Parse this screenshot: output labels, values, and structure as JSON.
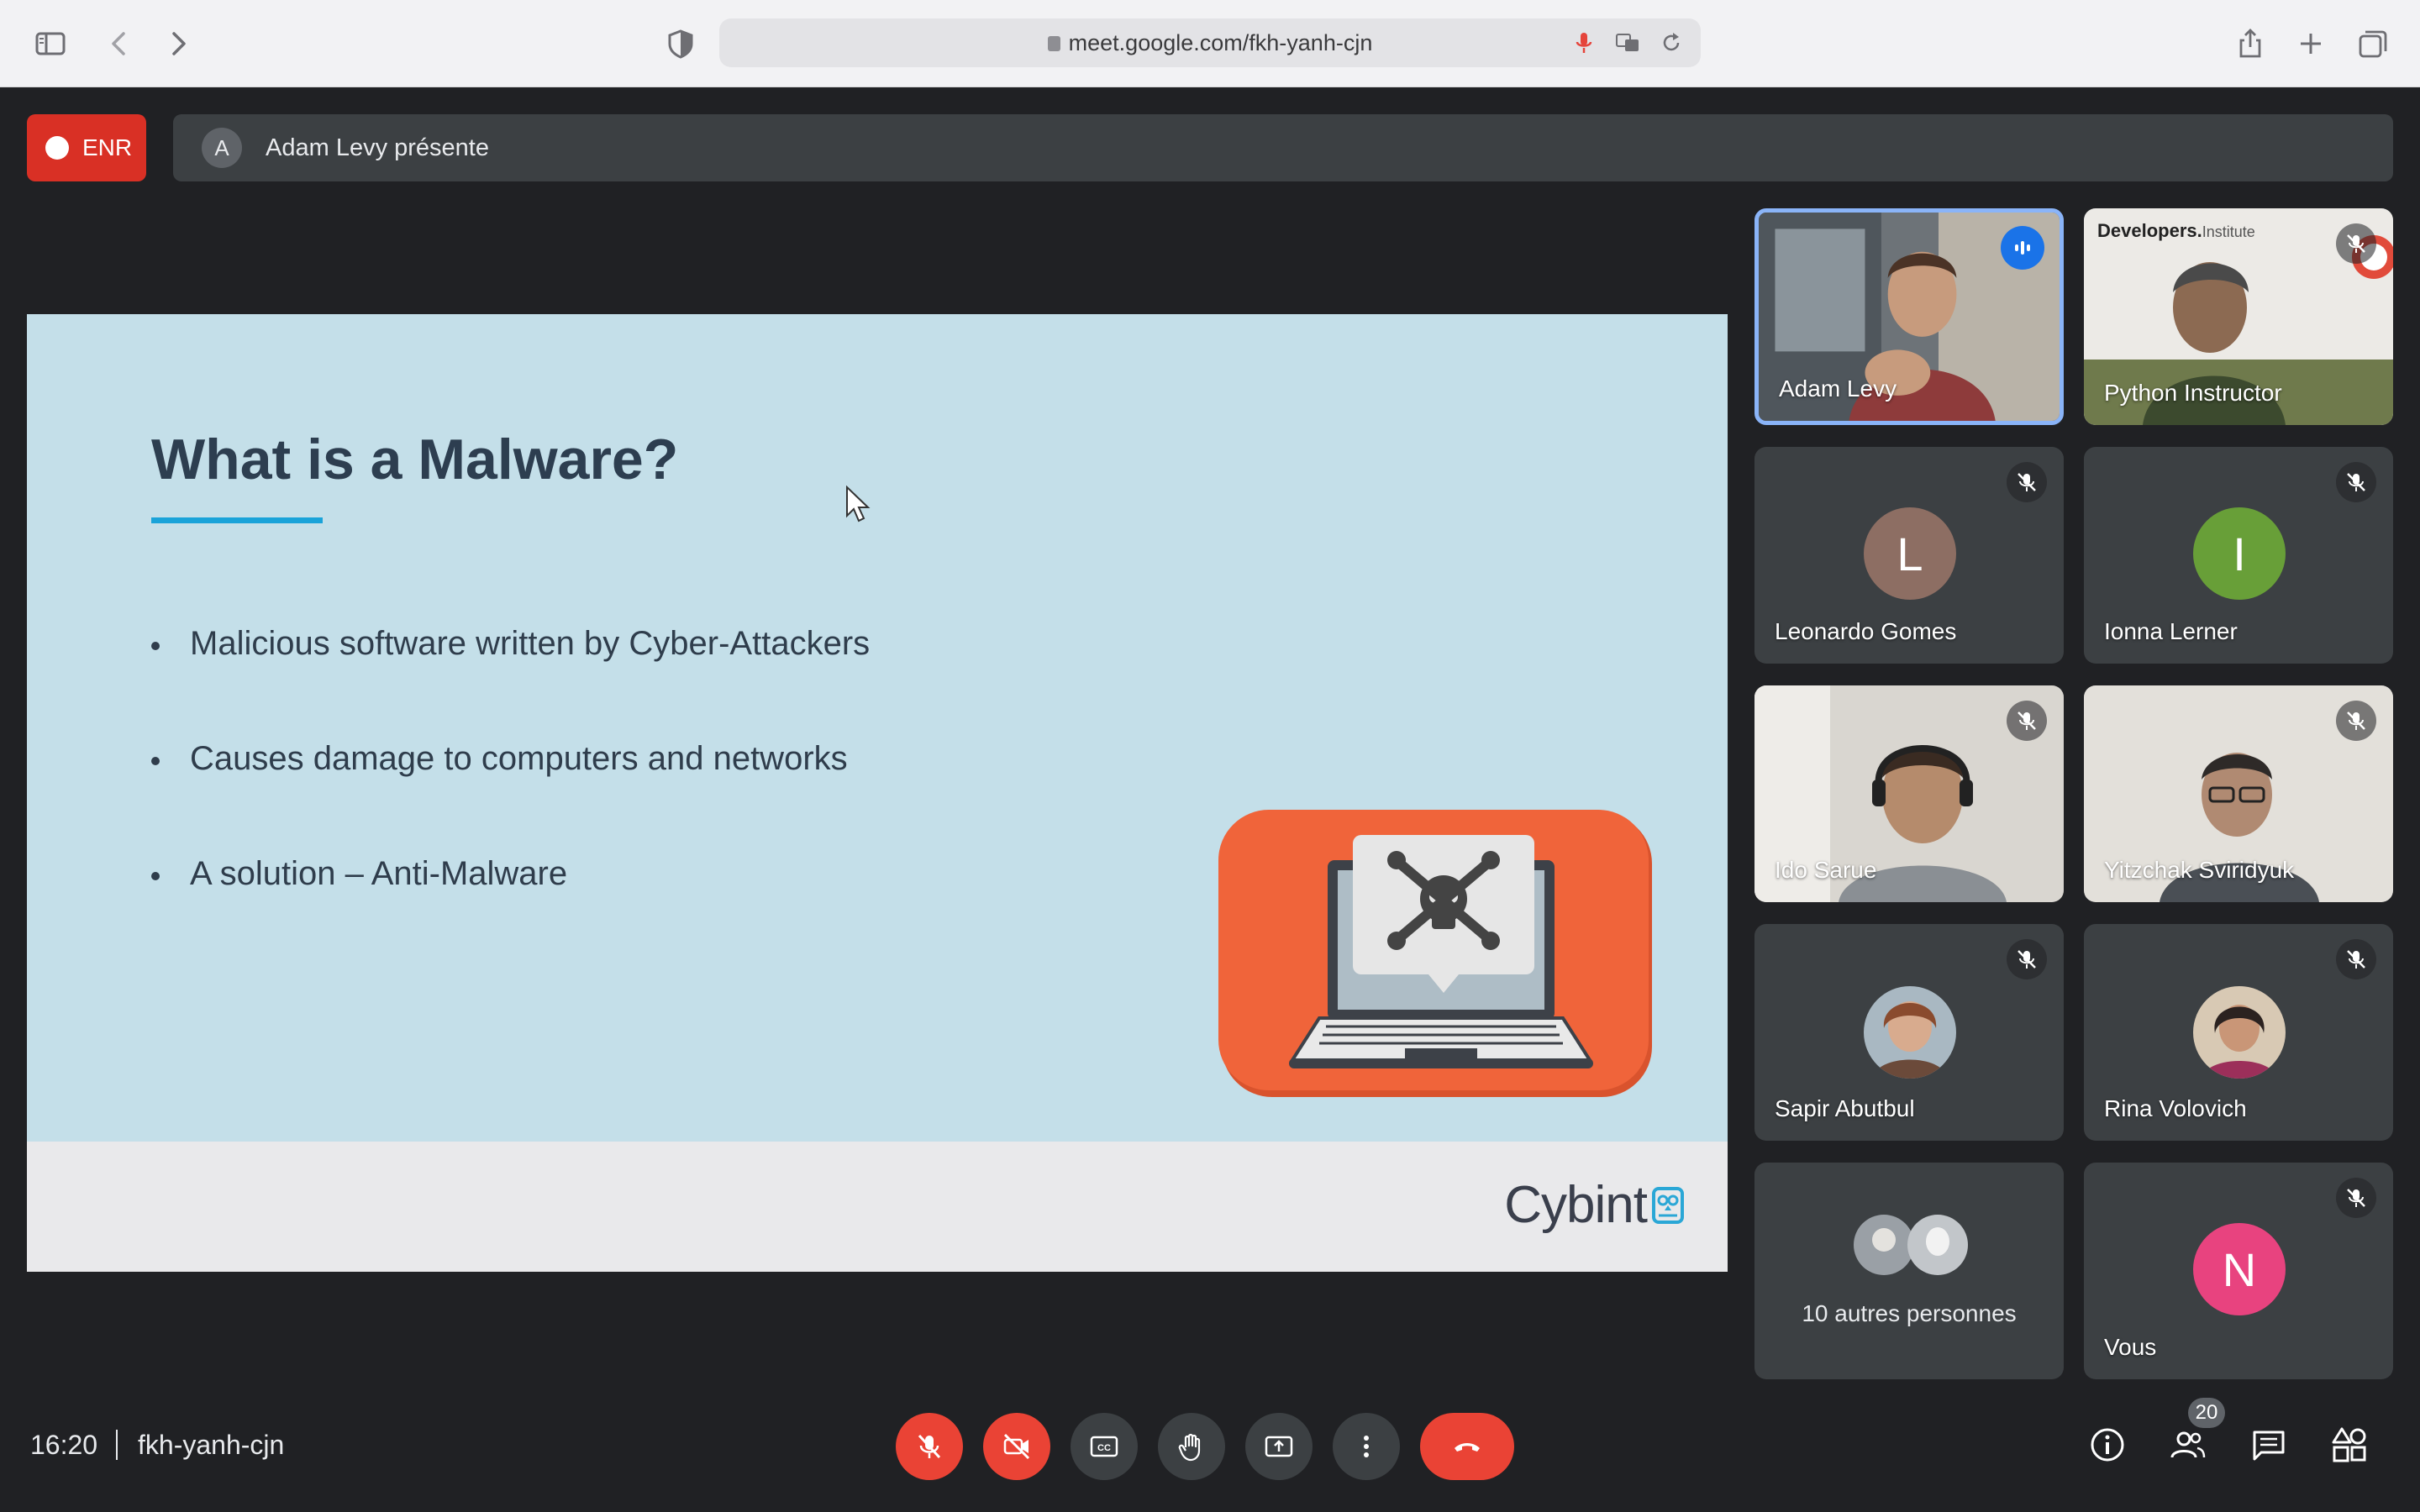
{
  "browser": {
    "url": "meet.google.com/fkh-yanh-cjn"
  },
  "meet": {
    "recording_label": "ENR",
    "presenter_initial": "A",
    "presenter_text": "Adam Levy présente",
    "time": "16:20",
    "meeting_code": "fkh-yanh-cjn",
    "participant_count": "20"
  },
  "slide": {
    "title": "What is a Malware?",
    "bullets": [
      "Malicious software written by Cyber-Attackers",
      "Causes damage to computers and networks",
      "A solution – Anti-Malware"
    ],
    "logo_text": "Cybint"
  },
  "participants": [
    {
      "name": "Adam Levy",
      "type": "video",
      "speaking": true
    },
    {
      "name": "Python Instructor",
      "type": "video",
      "muted": true
    },
    {
      "name": "Leonardo Gomes",
      "type": "initial",
      "initial": "L",
      "color": "#8d6e63",
      "muted": true
    },
    {
      "name": "Ionna Lerner",
      "type": "initial",
      "initial": "I",
      "color": "#689f38",
      "muted": true
    },
    {
      "name": "Ido Sarue",
      "type": "video",
      "muted": true
    },
    {
      "name": "Yitzchak Sviridyuk",
      "type": "video",
      "muted": true
    },
    {
      "name": "Sapir Abutbul",
      "type": "photo",
      "muted": true
    },
    {
      "name": "Rina Volovich",
      "type": "photo",
      "muted": true
    },
    {
      "name": "10 autres personnes",
      "type": "others"
    },
    {
      "name": "Vous",
      "type": "initial",
      "initial": "N",
      "color": "#e8437f",
      "muted": true
    }
  ],
  "tile_watermark": {
    "brand": "Developers.",
    "suffix": "Institute"
  },
  "colors": {
    "background": "#202124",
    "danger": "#ea4335",
    "accent": "#1a73e8",
    "slide_bg": "#c4dfe9"
  },
  "icons": {
    "mic": "mic-off-icon",
    "camera": "camera-off-icon",
    "captions": "captions-icon",
    "raise_hand": "raise-hand-icon",
    "present": "present-screen-icon",
    "more": "more-options-icon",
    "leave": "leave-call-icon",
    "info": "info-icon",
    "people": "people-icon",
    "chat": "chat-icon",
    "activities": "activities-icon"
  }
}
